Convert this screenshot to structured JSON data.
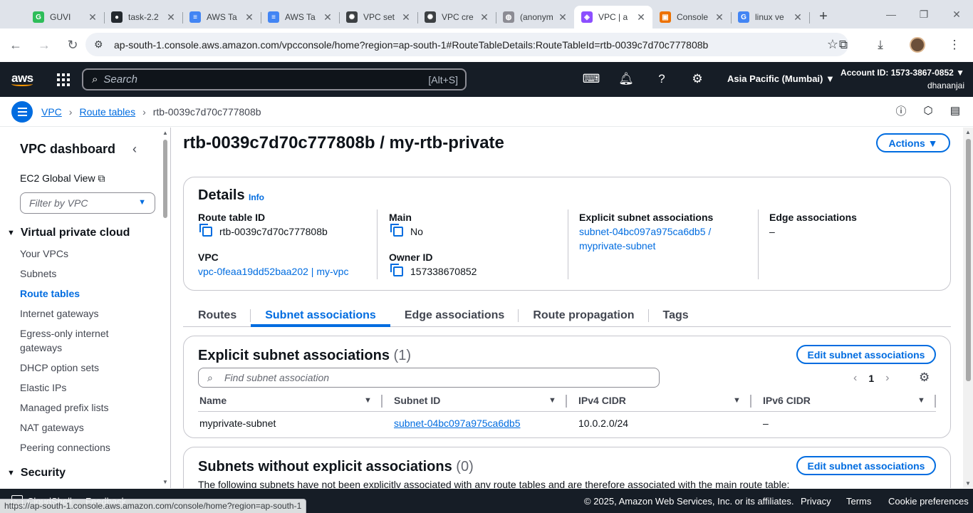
{
  "browser": {
    "tabs": [
      {
        "title": "GUVI",
        "icon": "guvi-icon",
        "color": "#2ebd59",
        "glyph": "G"
      },
      {
        "title": "task-2.2",
        "icon": "github-icon",
        "color": "#24292f",
        "glyph": "●"
      },
      {
        "title": "AWS Ta",
        "icon": "docs-icon",
        "color": "#4285f4",
        "glyph": "≡"
      },
      {
        "title": "AWS Ta",
        "icon": "docs-icon",
        "color": "#4285f4",
        "glyph": "≡"
      },
      {
        "title": "VPC set",
        "icon": "chatgpt-icon",
        "color": "#3c4043",
        "glyph": "✺"
      },
      {
        "title": "VPC cre",
        "icon": "chatgpt-icon",
        "color": "#3c4043",
        "glyph": "✺"
      },
      {
        "title": "(anonym",
        "icon": "globe-icon",
        "color": "#8c8c94",
        "glyph": "◍"
      },
      {
        "title": "VPC | a",
        "icon": "vpc-icon",
        "color": "#8c4fff",
        "glyph": "◈",
        "active": true
      },
      {
        "title": "Console",
        "icon": "aws-console-icon",
        "color": "#ed7100",
        "glyph": "▣"
      },
      {
        "title": "linux ve",
        "icon": "google-icon",
        "color": "#4285f4",
        "glyph": "G"
      }
    ],
    "url": "ap-south-1.console.aws.amazon.com/vpcconsole/home?region=ap-south-1#RouteTableDetails:RouteTableId=rtb-0039c7d70c777808b",
    "status_url": "https://ap-south-1.console.aws.amazon.com/console/home?region=ap-south-1"
  },
  "aws_nav": {
    "logo": "aws",
    "search_placeholder": "Search",
    "search_shortcut": "[Alt+S]",
    "region": "Asia Pacific (Mumbai) ▼",
    "account": "Account ID: 1573-3867-0852 ▼",
    "user": "dhananjai"
  },
  "breadcrumb": {
    "items": [
      "VPC",
      "Route tables"
    ],
    "current": "rtb-0039c7d70c777808b"
  },
  "sidebar": {
    "title": "VPC dashboard",
    "ec2_global": "EC2 Global View",
    "filter_placeholder": "Filter by VPC",
    "section_vpc": "Virtual private cloud",
    "items": [
      "Your VPCs",
      "Subnets",
      "Route tables",
      "Internet gateways",
      "Egress-only internet gateways",
      "DHCP option sets",
      "Elastic IPs",
      "Managed prefix lists",
      "NAT gateways",
      "Peering connections"
    ],
    "active_item": "Route tables",
    "section_security": "Security"
  },
  "page": {
    "title": "rtb-0039c7d70c777808b / my-rtb-private",
    "actions": "Actions ▼"
  },
  "details": {
    "heading": "Details",
    "info": "Info",
    "route_table_id_label": "Route table ID",
    "route_table_id": "rtb-0039c7d70c777808b",
    "vpc_label": "VPC",
    "vpc": "vpc-0feaa19dd52baa202 | my-vpc",
    "main_label": "Main",
    "main": "No",
    "owner_label": "Owner ID",
    "owner": "157338670852",
    "explicit_label": "Explicit subnet associations",
    "explicit_line1": "subnet-04bc097a975ca6db5 /",
    "explicit_line2": "myprivate-subnet",
    "edge_label": "Edge associations",
    "edge": "–"
  },
  "tabs": [
    "Routes",
    "Subnet associations",
    "Edge associations",
    "Route propagation",
    "Tags"
  ],
  "active_tab": "Subnet associations",
  "explicit": {
    "heading": "Explicit subnet associations",
    "count": "(1)",
    "edit_button": "Edit subnet associations",
    "find_placeholder": "Find subnet association",
    "page": "1",
    "columns": [
      "Name",
      "Subnet ID",
      "IPv4 CIDR",
      "IPv6 CIDR"
    ],
    "rows": [
      {
        "name": "myprivate-subnet",
        "subnet_id": "subnet-04bc097a975ca6db5",
        "ipv4": "10.0.2.0/24",
        "ipv6": "–"
      }
    ]
  },
  "without": {
    "heading": "Subnets without explicit associations",
    "count": "(0)",
    "edit_button": "Edit subnet associations",
    "text": "The following subnets have not been explicitly associated with any route tables and are therefore associated with the main route table:"
  },
  "footer": {
    "cloudshell": "CloudShell",
    "feedback": "Feedback",
    "copyright": "© 2025, Amazon Web Services, Inc. or its affiliates.",
    "privacy": "Privacy",
    "terms": "Terms",
    "cookies": "Cookie preferences"
  }
}
